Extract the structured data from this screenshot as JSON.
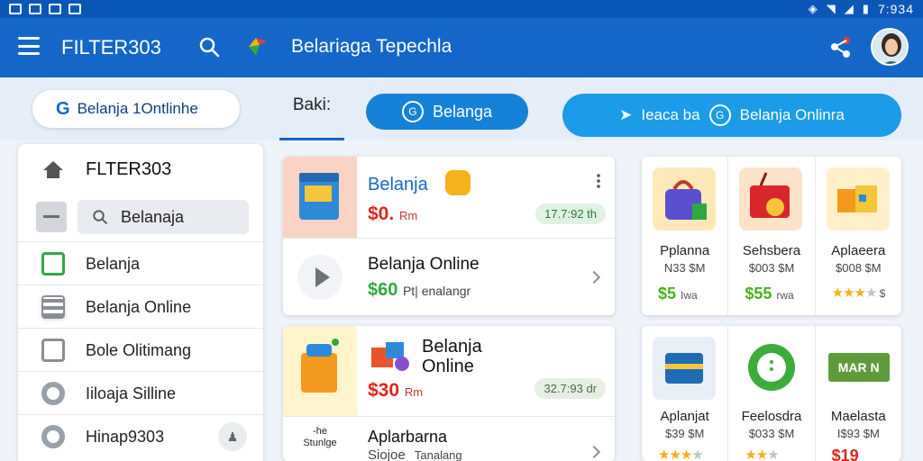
{
  "status_bar": {
    "time": "7:934"
  },
  "app_bar": {
    "title": "FILTER303",
    "subtitle": "Belariaga Tepechla"
  },
  "tabs": {
    "chip_left": "Belanja 1Ontlinhe",
    "baki": "Baki:",
    "chip_active": "Belanga",
    "chip_right_a": "Ieaca ba",
    "chip_right_b": "Belanja Onlinra"
  },
  "sidebar": {
    "title": "FLTER303",
    "search_value": "Belanaja",
    "items": [
      {
        "label": "Belanja",
        "icon": "green-square-icon"
      },
      {
        "label": "Belanja Online",
        "icon": "grid-icon"
      },
      {
        "label": "Bole Olitimang",
        "icon": "box-icon"
      },
      {
        "label": "Iiloaja Silline",
        "icon": "ring-icon"
      },
      {
        "label": "Hinap9303",
        "icon": "ring-icon"
      }
    ]
  },
  "cards": [
    {
      "name": "Belanja",
      "price": "$0.",
      "price_unit": "Rm",
      "pill": "17.7:92 th",
      "row_title": "Belanja Online",
      "row_price": "$60",
      "row_price_note": "Pt| enalangr"
    },
    {
      "name_line1": "Belanja",
      "name_line2": "Online",
      "price": "$30",
      "price_unit": "Rm",
      "pill": "32.7:93 dr",
      "thumb_label_1": "-he",
      "thumb_label_2": "Stunlge",
      "row_title": "Aplarbarna",
      "row_sub": "Siojoe",
      "row_sub2": "Tanalang"
    }
  ],
  "grid_top": [
    {
      "name": "Pplanna",
      "sub": "N33 $M",
      "price": "$5",
      "note": "Iwa",
      "kind": "price"
    },
    {
      "name": "Sehsbera",
      "sub": "$003 $M",
      "price": "$55",
      "note": "rwa",
      "kind": "price"
    },
    {
      "name": "Aplaeera",
      "sub": "$008 $M",
      "rating": 3,
      "note": "$",
      "kind": "stars"
    }
  ],
  "grid_bottom": [
    {
      "name": "Aplanjat",
      "sub": "$39 $M",
      "rating": 4
    },
    {
      "name": "Feelosdra",
      "sub": "$033 $M",
      "rating": 3
    },
    {
      "name": "Maelasta",
      "sub": "I$93 $M",
      "price": "$19",
      "label": "MAR N"
    }
  ]
}
